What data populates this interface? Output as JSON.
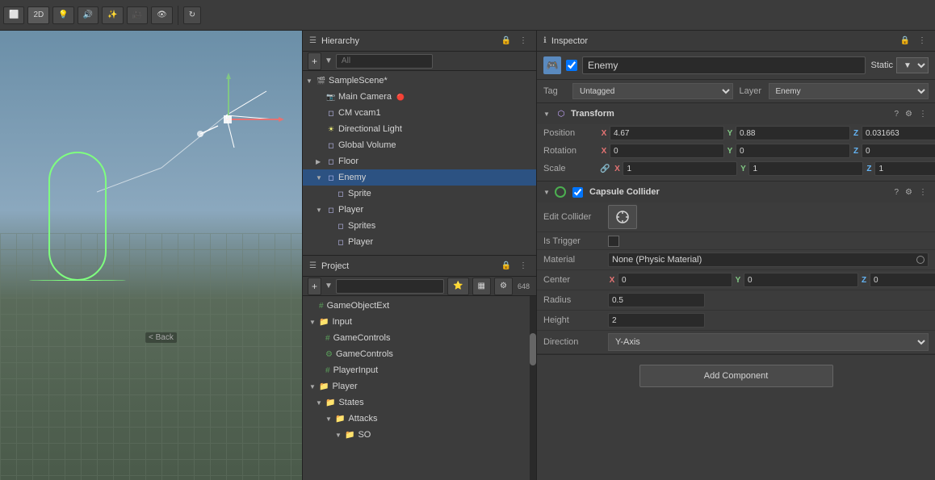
{
  "toolbar": {
    "btn2d": "2D",
    "back_label": "< Back"
  },
  "hierarchy": {
    "title": "Hierarchy",
    "search_placeholder": "All",
    "items": [
      {
        "id": "sample-scene",
        "label": "SampleScene*",
        "depth": 0,
        "expanded": true,
        "icon": "scene"
      },
      {
        "id": "main-camera",
        "label": "Main Camera",
        "depth": 1,
        "expanded": false,
        "icon": "camera",
        "has_warning": true
      },
      {
        "id": "cm-vcam1",
        "label": "CM vcam1",
        "depth": 1,
        "expanded": false,
        "icon": "obj"
      },
      {
        "id": "directional-light",
        "label": "Directional Light",
        "depth": 1,
        "expanded": false,
        "icon": "light"
      },
      {
        "id": "global-volume",
        "label": "Global Volume",
        "depth": 1,
        "expanded": false,
        "icon": "obj"
      },
      {
        "id": "floor",
        "label": "Floor",
        "depth": 1,
        "expanded": false,
        "icon": "obj",
        "has_arrow": true
      },
      {
        "id": "enemy",
        "label": "Enemy",
        "depth": 1,
        "expanded": true,
        "icon": "obj",
        "selected": true
      },
      {
        "id": "sprite",
        "label": "Sprite",
        "depth": 2,
        "expanded": false,
        "icon": "obj"
      },
      {
        "id": "player",
        "label": "Player",
        "depth": 1,
        "expanded": true,
        "icon": "obj"
      },
      {
        "id": "sprites",
        "label": "Sprites",
        "depth": 2,
        "expanded": false,
        "icon": "obj"
      },
      {
        "id": "player-child",
        "label": "Player",
        "depth": 2,
        "expanded": false,
        "icon": "obj"
      }
    ]
  },
  "project": {
    "title": "Project",
    "items": [
      {
        "id": "gameobjectext",
        "label": "GameObjectExt",
        "depth": 0,
        "icon": "script"
      },
      {
        "id": "input",
        "label": "Input",
        "depth": 0,
        "expanded": true,
        "icon": "folder"
      },
      {
        "id": "gamecontrols1",
        "label": "GameControls",
        "depth": 1,
        "icon": "script"
      },
      {
        "id": "gamecontrols2",
        "label": "GameControls",
        "depth": 1,
        "icon": "script2"
      },
      {
        "id": "playerinput",
        "label": "PlayerInput",
        "depth": 1,
        "icon": "script"
      },
      {
        "id": "player-folder",
        "label": "Player",
        "depth": 0,
        "expanded": true,
        "icon": "folder"
      },
      {
        "id": "states-folder",
        "label": "States",
        "depth": 1,
        "expanded": true,
        "icon": "folder"
      },
      {
        "id": "attacks-folder",
        "label": "Attacks",
        "depth": 2,
        "expanded": true,
        "icon": "folder"
      },
      {
        "id": "so-folder",
        "label": "SO",
        "depth": 3,
        "expanded": true,
        "icon": "folder"
      }
    ]
  },
  "inspector": {
    "title": "Inspector",
    "object_name": "Enemy",
    "tag": "Untagged",
    "layer": "Enemy",
    "static_label": "Static",
    "components": {
      "transform": {
        "title": "Transform",
        "position": {
          "x": "4.67",
          "y": "0.88",
          "z": "0.031663"
        },
        "rotation": {
          "x": "0",
          "y": "0",
          "z": "0"
        },
        "scale": {
          "x": "1",
          "y": "1",
          "z": "1"
        }
      },
      "capsule_collider": {
        "title": "Capsule Collider",
        "edit_collider_label": "Edit Collider",
        "is_trigger_label": "Is Trigger",
        "material_label": "Material",
        "material_value": "None (Physic Material)",
        "center_label": "Center",
        "center": {
          "x": "0",
          "y": "0",
          "z": "0"
        },
        "radius_label": "Radius",
        "radius_value": "0.5",
        "height_label": "Height",
        "height_value": "2",
        "direction_label": "Direction",
        "direction_value": "Y-Axis"
      }
    },
    "add_component_label": "Add Component"
  }
}
